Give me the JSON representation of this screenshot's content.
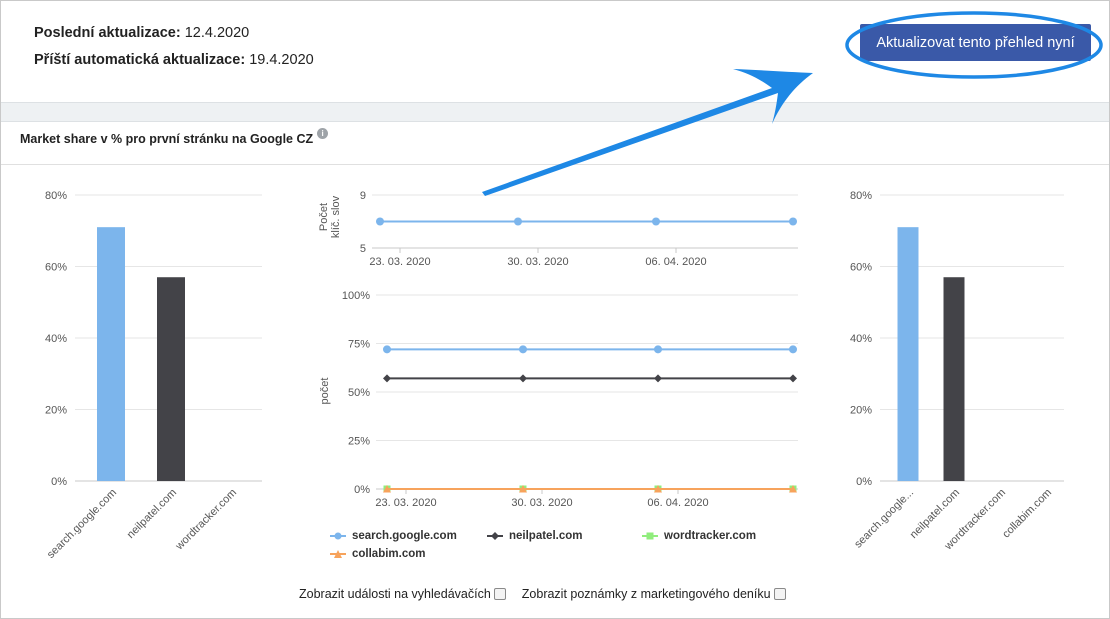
{
  "header": {
    "last_update_label": "Poslední aktualizace:",
    "last_update_value": "12.4.2020",
    "next_update_label": "Příští automatická aktualizace:",
    "next_update_value": "19.4.2020",
    "update_button_label": "Aktualizovat tento přehled nyní"
  },
  "section": {
    "title": "Market share v % pro první stránku na Google CZ",
    "info_icon_glyph": "i"
  },
  "controls": {
    "search_events_label": "Zobrazit události na vyhledávačích",
    "marketing_notes_label": "Zobrazit poznámky z marketingového deníku"
  },
  "colors": {
    "google": "#7cb5ec",
    "neilpatel": "#434348",
    "wordtracker": "#90ed7d",
    "collabim": "#f7a35c",
    "annotation_blue": "#1e88e5",
    "button": "#3a59a8"
  },
  "chart_data": [
    {
      "type": "bar",
      "categories": [
        "search.google.com",
        "neilpatel.com",
        "wordtracker.com"
      ],
      "values": [
        71,
        57,
        0
      ],
      "colors": [
        "#7cb5ec",
        "#434348",
        "#90ed7d"
      ],
      "ylim": [
        0,
        80
      ],
      "yticks": [
        0,
        20,
        40,
        60,
        80
      ],
      "ytick_labels": [
        "0%",
        "20%",
        "40%",
        "60%",
        "80%"
      ]
    },
    {
      "type": "line",
      "ylabel": "Počet klíč. slov",
      "ylim": [
        5,
        9
      ],
      "yticks": [
        5,
        9
      ],
      "ytick_labels": [
        "5",
        "9"
      ],
      "x_labels": [
        "23. 03. 2020",
        "30. 03. 2020",
        "06. 04. 2020"
      ],
      "series": [
        {
          "name": "search.google.com",
          "values": [
            7,
            7,
            7,
            7
          ],
          "color": "#7cb5ec"
        }
      ]
    },
    {
      "type": "line",
      "ylabel": "počet",
      "ylim": [
        0,
        100
      ],
      "yticks": [
        0,
        25,
        50,
        75,
        100
      ],
      "ytick_labels": [
        "0%",
        "25%",
        "50%",
        "75%",
        "100%"
      ],
      "x_labels": [
        "23. 03. 2020",
        "30. 03. 2020",
        "06. 04. 2020"
      ],
      "series": [
        {
          "name": "search.google.com",
          "values": [
            72,
            72,
            72,
            72
          ],
          "color": "#7cb5ec",
          "marker": "circle"
        },
        {
          "name": "neilpatel.com",
          "values": [
            57,
            57,
            57,
            57
          ],
          "color": "#434348",
          "marker": "diamond"
        },
        {
          "name": "wordtracker.com",
          "values": [
            0,
            0,
            0,
            0
          ],
          "color": "#90ed7d",
          "marker": "square"
        },
        {
          "name": "collabim.com",
          "values": [
            0,
            0,
            0,
            0
          ],
          "color": "#f7a35c",
          "marker": "triangle"
        }
      ]
    },
    {
      "type": "bar",
      "categories": [
        "search.google...",
        "neilpatel.com",
        "wordtracker.com",
        "collabim.com"
      ],
      "values": [
        71,
        57,
        0,
        0
      ],
      "colors": [
        "#7cb5ec",
        "#434348",
        "#90ed7d",
        "#f7a35c"
      ],
      "ylim": [
        0,
        80
      ],
      "yticks": [
        0,
        20,
        40,
        60,
        80
      ],
      "ytick_labels": [
        "0%",
        "20%",
        "40%",
        "60%",
        "80%"
      ]
    }
  ]
}
